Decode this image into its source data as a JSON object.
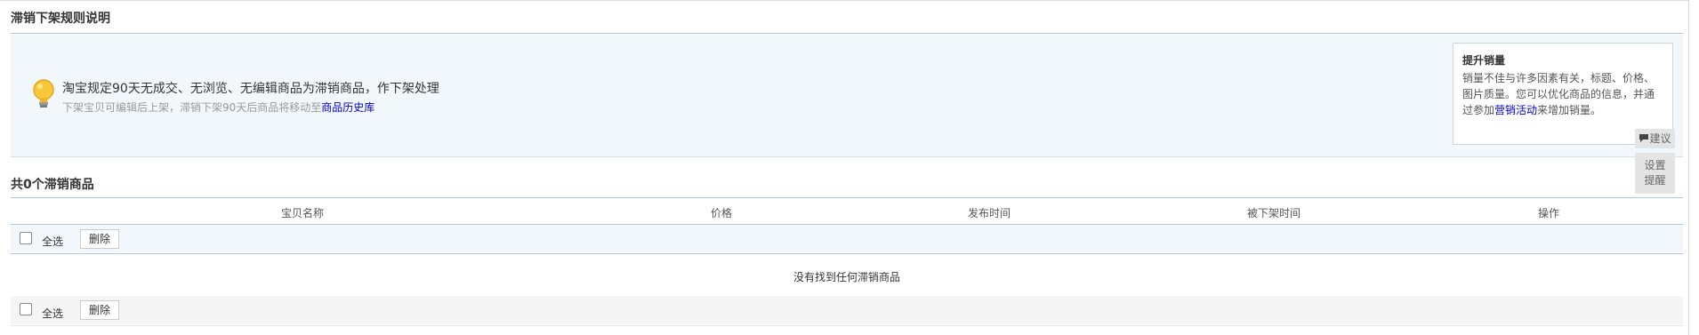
{
  "rules_section": {
    "title": "滞销下架规则说明",
    "main_text": "淘宝规定90天无成交、无浏览、无编辑商品为滞销商品，作下架处理",
    "sub_text": "下架宝贝可编辑后上架，滞销下架90天后商品将移动至",
    "sub_link": "商品历史库"
  },
  "suggestion_card": {
    "title": "提升销量",
    "body_part1": "销量不佳与许多因素有关，标题、价格、图片质量。您可以优化商品的信息，并通过参加",
    "body_link": "营销活动",
    "body_part2": "来增加销量。"
  },
  "side_buttons": {
    "suggest_label": "建议",
    "remind_label_line1": "设置",
    "remind_label_line2": "提醒"
  },
  "list_section": {
    "title": "共0个滞销商品"
  },
  "table": {
    "columns": [
      "宝贝名称",
      "价格",
      "发布时间",
      "被下架时间",
      "操作"
    ],
    "empty_message": "没有找到任何滞销商品"
  },
  "toolbar_top": {
    "select_all_label": "全选",
    "delete_label": "删除"
  },
  "toolbar_bottom": {
    "select_all_label": "全选",
    "delete_label": "删除"
  },
  "colors": {
    "info_bg": "#f2f7fc",
    "accent_line": "#a9c7e6",
    "link": "#0000cc",
    "footer_bg": "#f5f5f5"
  }
}
